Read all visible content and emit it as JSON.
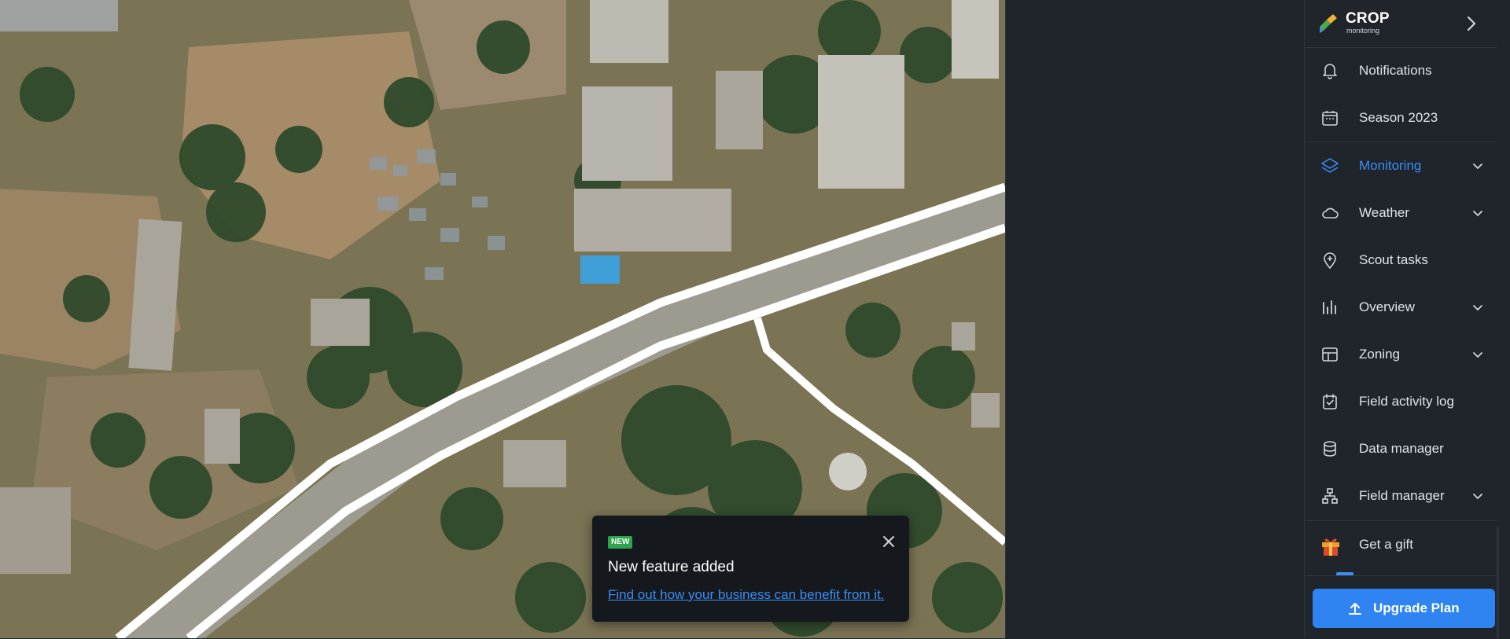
{
  "app": {
    "logo_title": "CROP",
    "logo_subtitle": "monitoring",
    "logo_icon": "crop-monitoring-logo",
    "brand_colors": {
      "accent": "#3d8df5",
      "upgrade": "#2f84f2",
      "new_badge": "#2fa44f",
      "sidebar_bg": "#1f252b"
    }
  },
  "sidebar": {
    "items": [
      {
        "label": "Notifications",
        "icon": "bell-icon",
        "expandable": false,
        "active": false
      },
      {
        "label": "Season 2023",
        "icon": "calendar-icon",
        "expandable": false,
        "active": false
      },
      {
        "label": "Monitoring",
        "icon": "layers-icon",
        "expandable": true,
        "active": true
      },
      {
        "label": "Weather",
        "icon": "cloud-icon",
        "expandable": true,
        "active": false
      },
      {
        "label": "Scout tasks",
        "icon": "map-pin-icon",
        "expandable": false,
        "active": false
      },
      {
        "label": "Overview",
        "icon": "bar-chart-icon",
        "expandable": true,
        "active": false
      },
      {
        "label": "Zoning",
        "icon": "layout-icon",
        "expandable": true,
        "active": false
      },
      {
        "label": "Field activity log",
        "icon": "calendar-check-icon",
        "expandable": false,
        "active": false
      },
      {
        "label": "Data manager",
        "icon": "database-icon",
        "expandable": false,
        "active": false
      },
      {
        "label": "Field manager",
        "icon": "hierarchy-icon",
        "expandable": true,
        "active": false
      }
    ],
    "gift_label": "Get a gift",
    "upgrade_label": "Upgrade Plan"
  },
  "toast": {
    "badge": "NEW",
    "title": "New feature added",
    "link": "Find out how your business can benefit from it."
  }
}
